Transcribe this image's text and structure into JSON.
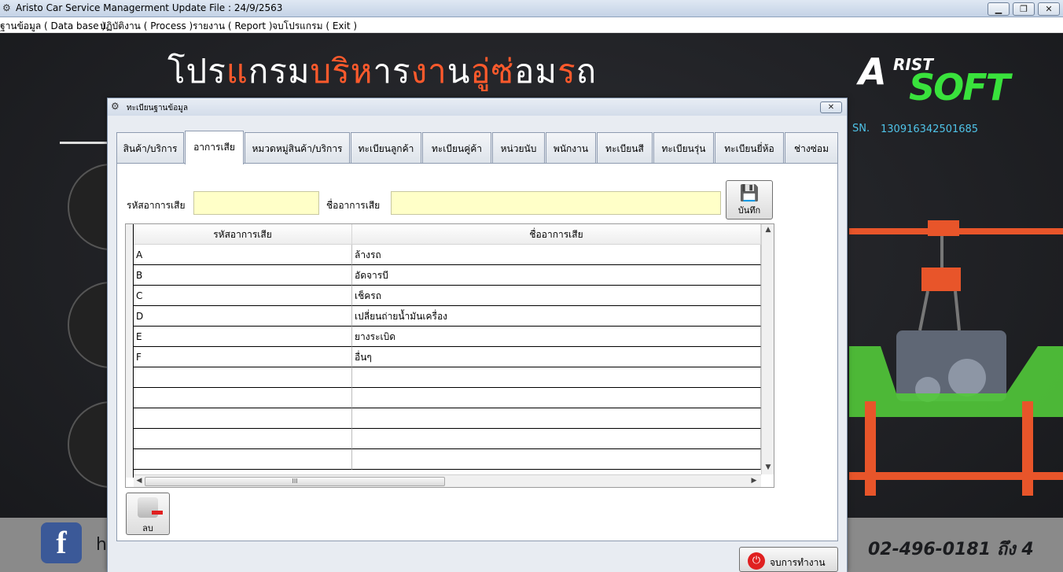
{
  "app": {
    "title": "Aristo Car Service Managerment   Update File : 24/9/2563",
    "title_icon": "gear-icon"
  },
  "menu": [
    "ฐานข้อมูล ( Data base )",
    "ปฏิบัติงาน ( Process )",
    "รายงาน ( Report )",
    "จบโปรแกรม ( Exit )"
  ],
  "background": {
    "headline_parts": [
      "โปร",
      "แ",
      "กรม",
      "บริ",
      "ห",
      "าร",
      "งา",
      "น",
      "อู่ซ่",
      "อม",
      "ร",
      "ถ"
    ],
    "logo_a": "A",
    "logo_rist": "RIST",
    "logo_soft": "SOFT",
    "sn_label": "SN.",
    "sn_value": "130916342501685",
    "phone": "02-496-0181 ถึง 4",
    "facebook_text": "h",
    "colors": {
      "accent_red": "#ff5a2c",
      "logo_green": "#39e23c",
      "sn_blue": "#4fc3e8"
    }
  },
  "dialog": {
    "title": "ทะเบียนฐานข้อมูล",
    "close_label": "✕",
    "tabs": [
      {
        "label": "สินค้า/บริการ",
        "active": false
      },
      {
        "label": "อาการเสีย",
        "active": true
      },
      {
        "label": "หมวดหมู่สินค้า/บริการ",
        "active": false
      },
      {
        "label": "ทะเบียนลูกค้า",
        "active": false
      },
      {
        "label": "ทะเบียนคู่ค้า",
        "active": false
      },
      {
        "label": "หน่วยนับ",
        "active": false
      },
      {
        "label": "พนักงาน",
        "active": false
      },
      {
        "label": "ทะเบียนสี",
        "active": false
      },
      {
        "label": "ทะเบียนรุ่น",
        "active": false
      },
      {
        "label": "ทะเบียนยี่ห้อ",
        "active": false
      },
      {
        "label": "ช่างซ่อม",
        "active": false
      }
    ],
    "form": {
      "code_label": "รหัสอาการเสีย",
      "code_value": "",
      "name_label": "ชื่ออาการเสีย",
      "name_value": "",
      "save_label": "บันทึก"
    },
    "grid": {
      "columns": [
        "รหัสอาการเสีย",
        "ชื่ออาการเสีย"
      ],
      "rows": [
        [
          "A",
          "ล้างรถ"
        ],
        [
          "B",
          "อัดจารบี"
        ],
        [
          "C",
          "เช็ครถ"
        ],
        [
          "D",
          "เปลี่ยนถ่ายน้ำมันเครื่อง"
        ],
        [
          "E",
          "ยางระเบิด"
        ],
        [
          "F",
          "อื่นๆ"
        ],
        [
          "",
          ""
        ],
        [
          "",
          ""
        ],
        [
          "",
          ""
        ],
        [
          "",
          ""
        ],
        [
          "",
          ""
        ]
      ],
      "hscroll_grip": "III"
    },
    "delete_label": "ลบ",
    "exit_label": "จบการทำงาน"
  }
}
